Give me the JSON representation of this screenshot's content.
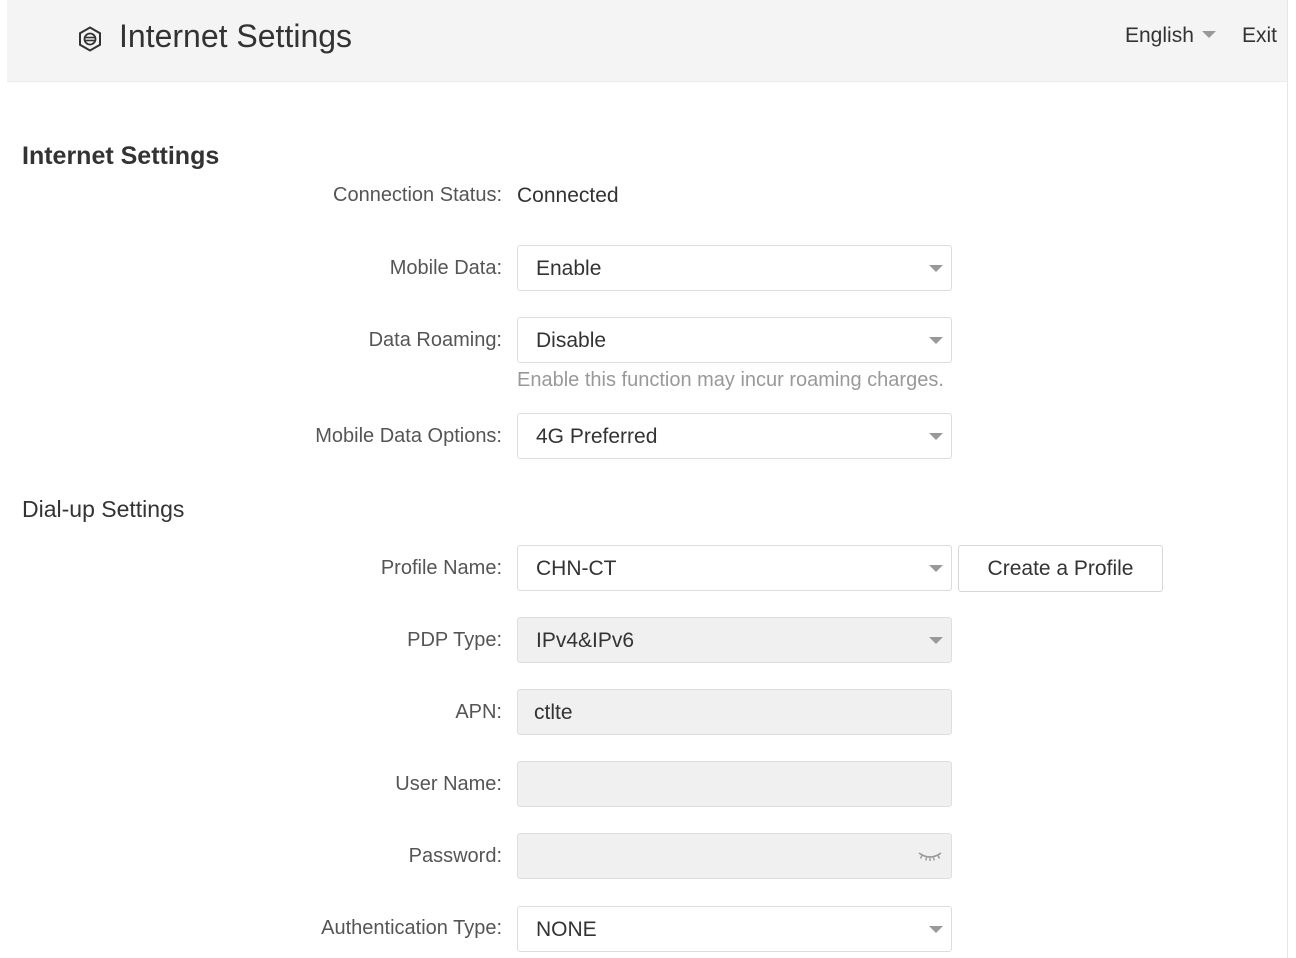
{
  "header": {
    "title": "Internet Settings",
    "icon": "network-settings-icon",
    "language": "English",
    "exit_label": "Exit"
  },
  "internet": {
    "section_title": "Internet Settings",
    "connection_status": {
      "label": "Connection Status:",
      "value": "Connected"
    },
    "mobile_data": {
      "label": "Mobile Data:",
      "value": "Enable"
    },
    "data_roaming": {
      "label": "Data Roaming:",
      "value": "Disable",
      "hint": "Enable this function may incur roaming charges."
    },
    "mobile_data_options": {
      "label": "Mobile Data Options:",
      "value": "4G Preferred"
    }
  },
  "dialup": {
    "section_title": "Dial-up Settings",
    "profile_name": {
      "label": "Profile Name:",
      "value": "CHN-CT",
      "create_button": "Create a Profile"
    },
    "pdp_type": {
      "label": "PDP Type:",
      "value": "IPv4&IPv6"
    },
    "apn": {
      "label": "APN:",
      "value": "ctlte"
    },
    "user_name": {
      "label": "User Name:",
      "value": ""
    },
    "password": {
      "label": "Password:",
      "value": "",
      "icon": "eye-closed-icon"
    },
    "authentication_type": {
      "label": "Authentication Type:",
      "value": "NONE"
    }
  },
  "colors": {
    "header_bg": "#f4f4f4",
    "disabled_field_bg": "#f0f0f0",
    "hint_text": "#999999",
    "border": "#dddddd"
  }
}
